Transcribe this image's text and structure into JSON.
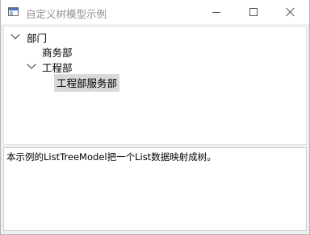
{
  "window": {
    "title": "自定义树模型示例",
    "icon": "qt-window-icon",
    "controls": {
      "minimize_icon": "minimize-icon",
      "maximize_icon": "maximize-icon",
      "close_icon": "close-icon"
    }
  },
  "tree": {
    "items": [
      {
        "label": "部门",
        "level": 0,
        "expanded": true
      },
      {
        "label": "商务部",
        "level": 1,
        "expanded": null
      },
      {
        "label": "工程部",
        "level": 1,
        "expanded": true
      },
      {
        "label": "工程部服务部",
        "level": 2,
        "expanded": null,
        "selected": true
      }
    ]
  },
  "textarea": {
    "content": "本示例的ListTreeModel把一个List数据映射成树。"
  },
  "colors": {
    "selection_background": "#d9d9d9",
    "title_text": "#909090",
    "window_background": "#f0f0f0"
  }
}
